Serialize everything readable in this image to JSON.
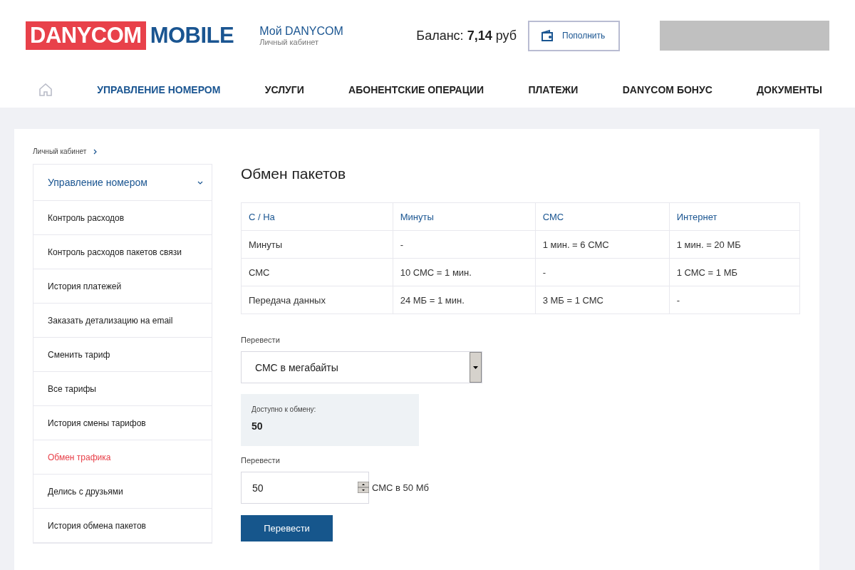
{
  "logo": {
    "part_1": "DANYCOM",
    "part_2": "MOBILE"
  },
  "account": {
    "title": "Мой DANYCOM",
    "subtitle": "Личный кабинет"
  },
  "balance": {
    "text": "Баланс: **7,14** руб"
  },
  "topup_button": {
    "label": "Пополнить"
  },
  "nav": [
    {
      "label": "УПРАВЛЕНИЕ НОМЕРОМ",
      "selected": true
    },
    {
      "label": "УСЛУГИ",
      "selected": false
    },
    {
      "label": "АБОНЕНТСКИЕ ОПЕРАЦИИ",
      "selected": false
    },
    {
      "label": "ПЛАТЕЖИ",
      "selected": false
    },
    {
      "label": "DANYCOM БОНУС",
      "selected": false
    },
    {
      "label": "ДОКУМЕНТЫ",
      "selected": false
    }
  ],
  "breadcrumb": [
    "Личный кабинет"
  ],
  "sidebar": {
    "header": {
      "label": "Управление номером",
      "expanded": true
    },
    "items": [
      {
        "label": "Контроль расходов",
        "selected": false
      },
      {
        "label": "Контроль расходов пакетов связи",
        "selected": false
      },
      {
        "label": "История платежей",
        "selected": false
      },
      {
        "label": "Заказать детализацию на email",
        "selected": false
      },
      {
        "label": "Сменить тариф",
        "selected": false
      },
      {
        "label": "Все тарифы",
        "selected": false
      },
      {
        "label": "История смены тарифов",
        "selected": false
      },
      {
        "label": "Обмен трафика",
        "selected": true
      },
      {
        "label": "Делись с друзьями",
        "selected": false
      },
      {
        "label": "История обмена пакетов",
        "selected": false
      }
    ]
  },
  "page_title": "Обмен пакетов",
  "table": {
    "columns": [
      "С / На",
      "Минуты",
      "СМС",
      "Интернет"
    ],
    "rows": [
      [
        "Минуты",
        "-",
        "1 мин. = 6 СМС",
        "1 мин. = 20 МБ"
      ],
      [
        "СМС",
        "10 СМС = 1 мин.",
        "-",
        "1 СМС = 1 МБ"
      ],
      [
        "Передача данных",
        "24 МБ = 1 мин.",
        "3 МБ = 1 СМС",
        "-"
      ]
    ]
  },
  "convert_select": {
    "label": "Перевести",
    "value": "СМС в мегабайты"
  },
  "available": {
    "label": "Доступно к обмену:",
    "value": "50"
  },
  "amount": {
    "label": "Перевести",
    "value": "50",
    "result": "СМС в 50 Мб"
  },
  "submit_button": {
    "label": "Перевести"
  }
}
